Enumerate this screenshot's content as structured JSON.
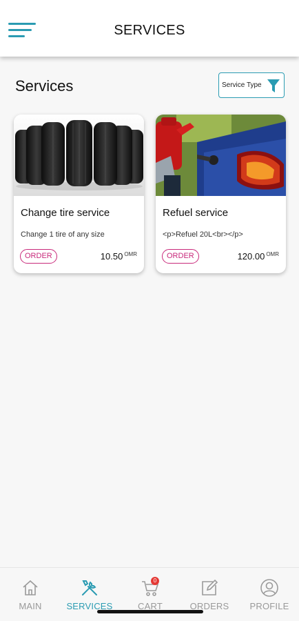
{
  "header": {
    "title": "SERVICES"
  },
  "page": {
    "title": "Services",
    "filter_label": "Service Type"
  },
  "services": [
    {
      "name": "Change tire service",
      "description": "Change 1 tire of any size",
      "order_label": "ORDER",
      "price": "10.50",
      "currency": "OMR"
    },
    {
      "name": "Refuel service",
      "description": "<p>Refuel 20L<br></p>",
      "order_label": "ORDER",
      "price": "120.00",
      "currency": "OMR"
    }
  ],
  "bottom_nav": {
    "items": [
      {
        "label": "MAIN",
        "icon": "home-icon"
      },
      {
        "label": "SERVICES",
        "icon": "tools-icon",
        "active": true
      },
      {
        "label": "CART",
        "icon": "cart-icon",
        "badge": "0"
      },
      {
        "label": "ORDERS",
        "icon": "edit-icon"
      },
      {
        "label": "PROFILE",
        "icon": "user-icon"
      }
    ]
  },
  "colors": {
    "accent": "#2a9bb2",
    "order": "#c8287a",
    "badge": "#e53935"
  }
}
